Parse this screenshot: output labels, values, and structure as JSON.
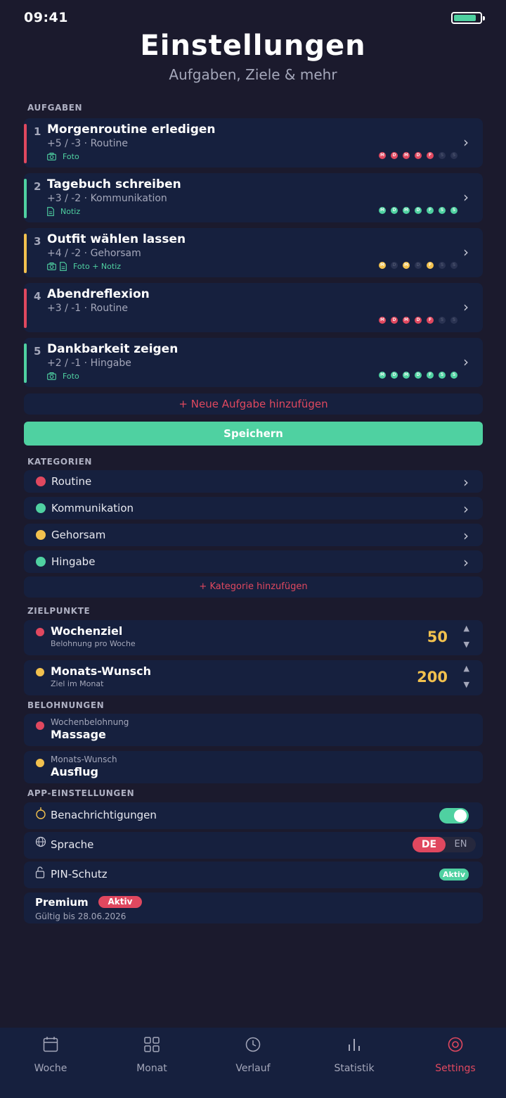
{
  "status_bar": {
    "time": "09:41",
    "battery_level": 0.85
  },
  "header": {
    "title": "Einstellungen",
    "subtitle": "Aufgaben, Ziele & mehr"
  },
  "colors": {
    "routine": "#e0485f",
    "kommunikation": "#4fd1a1",
    "gehorsam": "#f2c14e",
    "hingabe": "#4fd1a1",
    "accent": "#e0485f",
    "card": "#16203e",
    "background": "#1b1a2d"
  },
  "tasks_section": {
    "label": "AUFGABEN",
    "tasks": [
      {
        "number": "1",
        "title": "Morgenroutine erledigen",
        "sub": "+5 / -3 · Routine",
        "color": "#e0485f",
        "attach_label": "Foto",
        "attach_icons": [
          "camera-icon"
        ],
        "days": [
          "M",
          "D",
          "M",
          "D",
          "F",
          "S",
          "S"
        ],
        "active_days": [
          true,
          true,
          true,
          true,
          true,
          false,
          false
        ]
      },
      {
        "number": "2",
        "title": "Tagebuch schreiben",
        "sub": "+3 / -2 · Kommunikation",
        "color": "#4fd1a1",
        "attach_label": "Notiz",
        "attach_icons": [
          "note-icon"
        ],
        "days": [
          "M",
          "D",
          "M",
          "D",
          "F",
          "S",
          "S"
        ],
        "active_days": [
          true,
          true,
          true,
          true,
          true,
          true,
          true
        ]
      },
      {
        "number": "3",
        "title": "Outfit wählen lassen",
        "sub": "+4 / -2 · Gehorsam",
        "color": "#f2c14e",
        "attach_label": "Foto + Notiz",
        "attach_icons": [
          "camera-icon",
          "note-icon"
        ],
        "days": [
          "M",
          "D",
          "M",
          "D",
          "F",
          "S",
          "S"
        ],
        "active_days": [
          true,
          false,
          true,
          false,
          true,
          false,
          false
        ]
      },
      {
        "number": "4",
        "title": "Abendreflexion",
        "sub": "+3 / -1 · Routine",
        "color": "#e0485f",
        "attach_label": "",
        "attach_icons": [],
        "days": [
          "M",
          "D",
          "M",
          "D",
          "F",
          "S",
          "S"
        ],
        "active_days": [
          true,
          true,
          true,
          true,
          true,
          false,
          false
        ]
      },
      {
        "number": "5",
        "title": "Dankbarkeit zeigen",
        "sub": "+2 / -1 · Hingabe",
        "color": "#4fd1a1",
        "attach_label": "Foto",
        "attach_icons": [
          "camera-icon"
        ],
        "days": [
          "M",
          "D",
          "M",
          "D",
          "F",
          "S",
          "S"
        ],
        "active_days": [
          true,
          true,
          true,
          true,
          true,
          true,
          true
        ]
      }
    ],
    "add_label": "+ Neue Aufgabe hinzufügen",
    "save_label": "Speichern"
  },
  "categories_section": {
    "label": "KATEGORIEN",
    "items": [
      {
        "name": "Routine",
        "color": "#e0485f"
      },
      {
        "name": "Kommunikation",
        "color": "#4fd1a1"
      },
      {
        "name": "Gehorsam",
        "color": "#f2c14e"
      },
      {
        "name": "Hingabe",
        "color": "#4fd1a1"
      }
    ],
    "add_label": "+ Kategorie hinzufügen"
  },
  "goals_section": {
    "label": "ZIELPUNKTE",
    "weekly": {
      "title": "Wochenziel",
      "sub": "Belohnung pro Woche",
      "value": "50",
      "color": "#e0485f"
    },
    "monthly": {
      "title": "Monats-Wunsch",
      "sub": "Ziel im Monat",
      "value": "200",
      "color": "#f2c14e"
    },
    "stepper_up": "▲",
    "stepper_down": "▼"
  },
  "rewards_section": {
    "label": "BELOHNUNGEN",
    "weekly": {
      "label": "Wochenbelohnung",
      "value": "Massage",
      "color": "#e0485f"
    },
    "monthly": {
      "label": "Monats-Wunsch",
      "value": "Ausflug",
      "color": "#f2c14e"
    }
  },
  "app_settings": {
    "label": "APP-EINSTELLUNGEN",
    "notifications_label": "Benachrichtigungen",
    "notifications_on": true,
    "language_label": "Sprache",
    "lang_de": "DE",
    "lang_en": "EN",
    "lang_selected": "DE",
    "pin_label": "PIN-Schutz",
    "pin_status": "Aktiv"
  },
  "premium": {
    "title": "Premium",
    "badge": "Aktiv",
    "valid_until": "Gültig bis 28.06.2026"
  },
  "tabbar": {
    "tabs": [
      {
        "label": "Woche",
        "icon": "calendar-icon"
      },
      {
        "label": "Monat",
        "icon": "grid-icon"
      },
      {
        "label": "Verlauf",
        "icon": "clock-icon"
      },
      {
        "label": "Statistik",
        "icon": "bar-chart-icon"
      },
      {
        "label": "Settings",
        "icon": "target-icon",
        "active": true
      }
    ]
  }
}
